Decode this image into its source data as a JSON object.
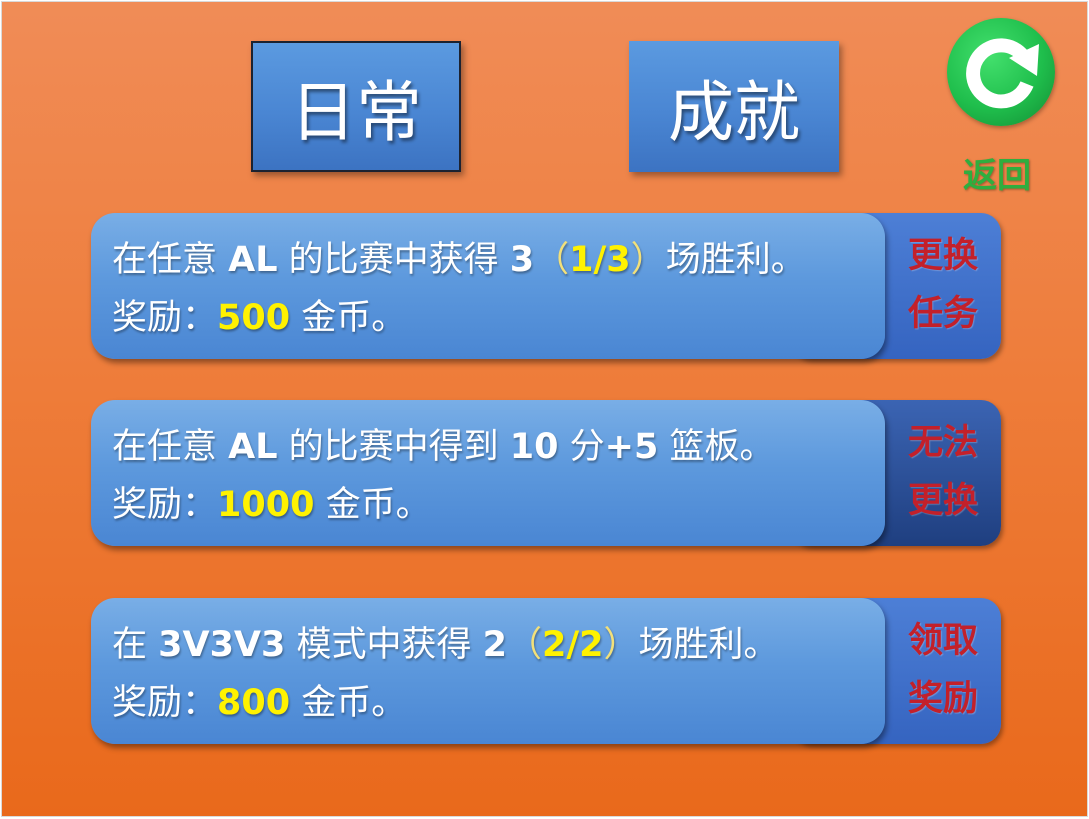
{
  "tabs": {
    "daily": "日常",
    "achievement": "成就"
  },
  "back": {
    "label": "返回",
    "icon": "refresh-back-icon"
  },
  "tasks": [
    {
      "pre": "在任意 ",
      "mode": "AL",
      "mid": " 的比赛中获得 ",
      "count": "3",
      "open_paren": "（",
      "progress": "1/3",
      "close_paren": "）",
      "post": "场胜利。",
      "reward_label": "奖励：",
      "reward": "500",
      "reward_unit": " 金币。",
      "action_line1": "更换",
      "action_line2": "任务"
    },
    {
      "pre": "在任意 ",
      "mode": "AL",
      "mid": " 的比赛中得到 ",
      "points": "10",
      "mid2": " 分",
      "plus": "+5",
      "post": " 篮板。",
      "reward_label": "奖励：",
      "reward": "1000",
      "reward_unit": " 金币。",
      "action_line1": "无法",
      "action_line2": "更换"
    },
    {
      "pre": "在 ",
      "mode": "3V3V3",
      "mid": " 模式中获得 ",
      "count": "2",
      "open_paren": "（",
      "progress": "2/2",
      "close_paren": "）",
      "post": "场胜利。",
      "reward_label": "奖励：",
      "reward": "800",
      "reward_unit": " 金币。",
      "action_line1": "领取",
      "action_line2": "奖励"
    }
  ],
  "colors": {
    "background": "#ee7d3b",
    "card": "#5d99dd",
    "highlight": "#fff200",
    "action_text": "#c3202a",
    "back_green": "#1fbe4c"
  }
}
